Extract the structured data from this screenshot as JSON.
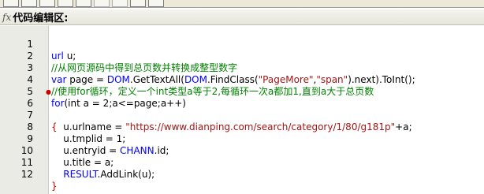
{
  "toolbar": {
    "buttons": [
      "",
      "",
      "",
      "",
      "",
      "",
      "",
      "",
      ""
    ]
  },
  "header": {
    "icon": "fx-icon",
    "title": "代码编辑区:"
  },
  "colors": {
    "keyword": "#0000ff",
    "comment": "#008000",
    "string": "#a31515",
    "brace": "#c00000",
    "gutter": "#ebebe6"
  },
  "editor": {
    "lines": [
      {
        "n": "1"
      },
      {
        "n": "2"
      },
      {
        "n": "3"
      },
      {
        "n": "4"
      },
      {
        "n": "5"
      },
      {
        "n": "6"
      },
      {
        "n": "7"
      },
      {
        "n": "8"
      },
      {
        "n": "9"
      },
      {
        "n": "10"
      },
      {
        "n": "11"
      },
      {
        "n": "12"
      }
    ],
    "tokens": {
      "l1_kw": "url",
      "l1_rest": " u;",
      "l2_cm": "//从网页源码中得到总页数并转换成整型数字",
      "l3_kw": "var",
      "l3_a": " page = ",
      "l3_obj1": "DOM",
      "l3_b": ".GetTextAll(",
      "l3_obj2": "DOM",
      "l3_c": ".FindClass(",
      "l3_s1": "\"PageMore\"",
      "l3_d": ",",
      "l3_s2": "\"span\"",
      "l3_e": ").next).ToInt();",
      "l4_cm": "//使用for循环，定义一个int类型a等于2,每循环一次a都加1,直到a大于总页数",
      "l5_kw": "for",
      "l5_rest": "(int a = 2;a<=page;a++)",
      "l6_brace": "{",
      "l7_a": "    u.urlname = ",
      "l7_s": "\"https://www.dianping.com/search/category/1/80/g181p\"",
      "l7_b": "+a;",
      "l8": "    u.tmplid = 1;",
      "l9_a": "    u.entryid = ",
      "l9_obj": "CHANN",
      "l9_b": ".id;",
      "l10": "    u.title = a;",
      "l11_obj": "    RESULT",
      "l11_b": ".AddLink(u);",
      "l12_brace": "}"
    }
  }
}
